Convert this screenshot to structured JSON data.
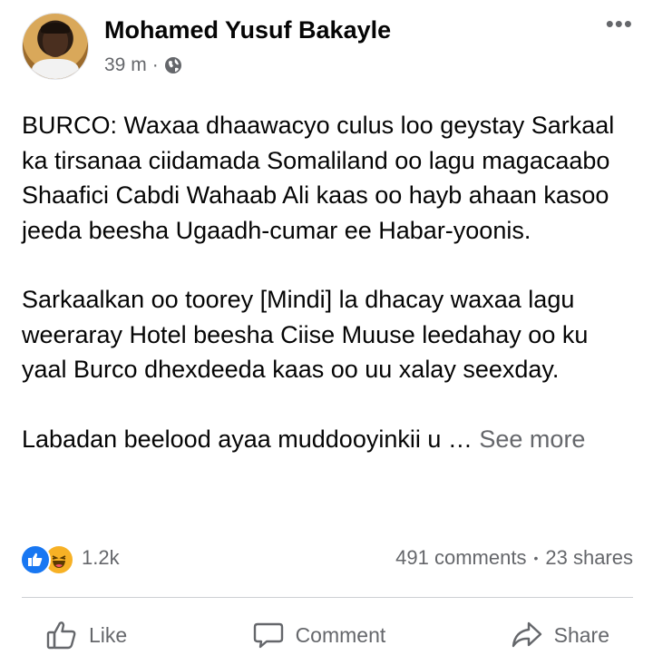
{
  "post": {
    "author": "Mohamed Yusuf Bakayle",
    "time": "39 m",
    "separator": "·",
    "privacy_icon": "globe-icon",
    "more_icon": "•••",
    "paragraphs": [
      "BURCO: Waxaa dhaawacyo culus loo geystay Sarkaal ka tirsanaa ciidamada Somaliland oo lagu magacaabo Shaafici Cabdi Wahaab Ali kaas oo hayb ahaan kasoo jeeda beesha Ugaadh-cumar ee Habar-yoonis.",
      "Sarkaalkan oo toorey [Mindi] la dhacay waxaa lagu weeraray Hotel beesha Ciise Muuse leedahay oo ku yaal Burco dhexdeeda kaas oo uu xalay seexday.",
      "Labadan beelood ayaa muddooyinkii u …"
    ],
    "see_more": "See more"
  },
  "engagement": {
    "reaction_icons": [
      "like-reaction-icon",
      "haha-reaction-icon"
    ],
    "reaction_count": "1.2k",
    "comments": "491 comments",
    "dot": "•",
    "shares": "23 shares"
  },
  "actions": {
    "like": "Like",
    "comment": "Comment",
    "share": "Share"
  },
  "colors": {
    "like_blue": "#1877f2",
    "haha_yellow": "#f7b125",
    "secondary_text": "#65676b",
    "divider": "#ced0d4"
  }
}
